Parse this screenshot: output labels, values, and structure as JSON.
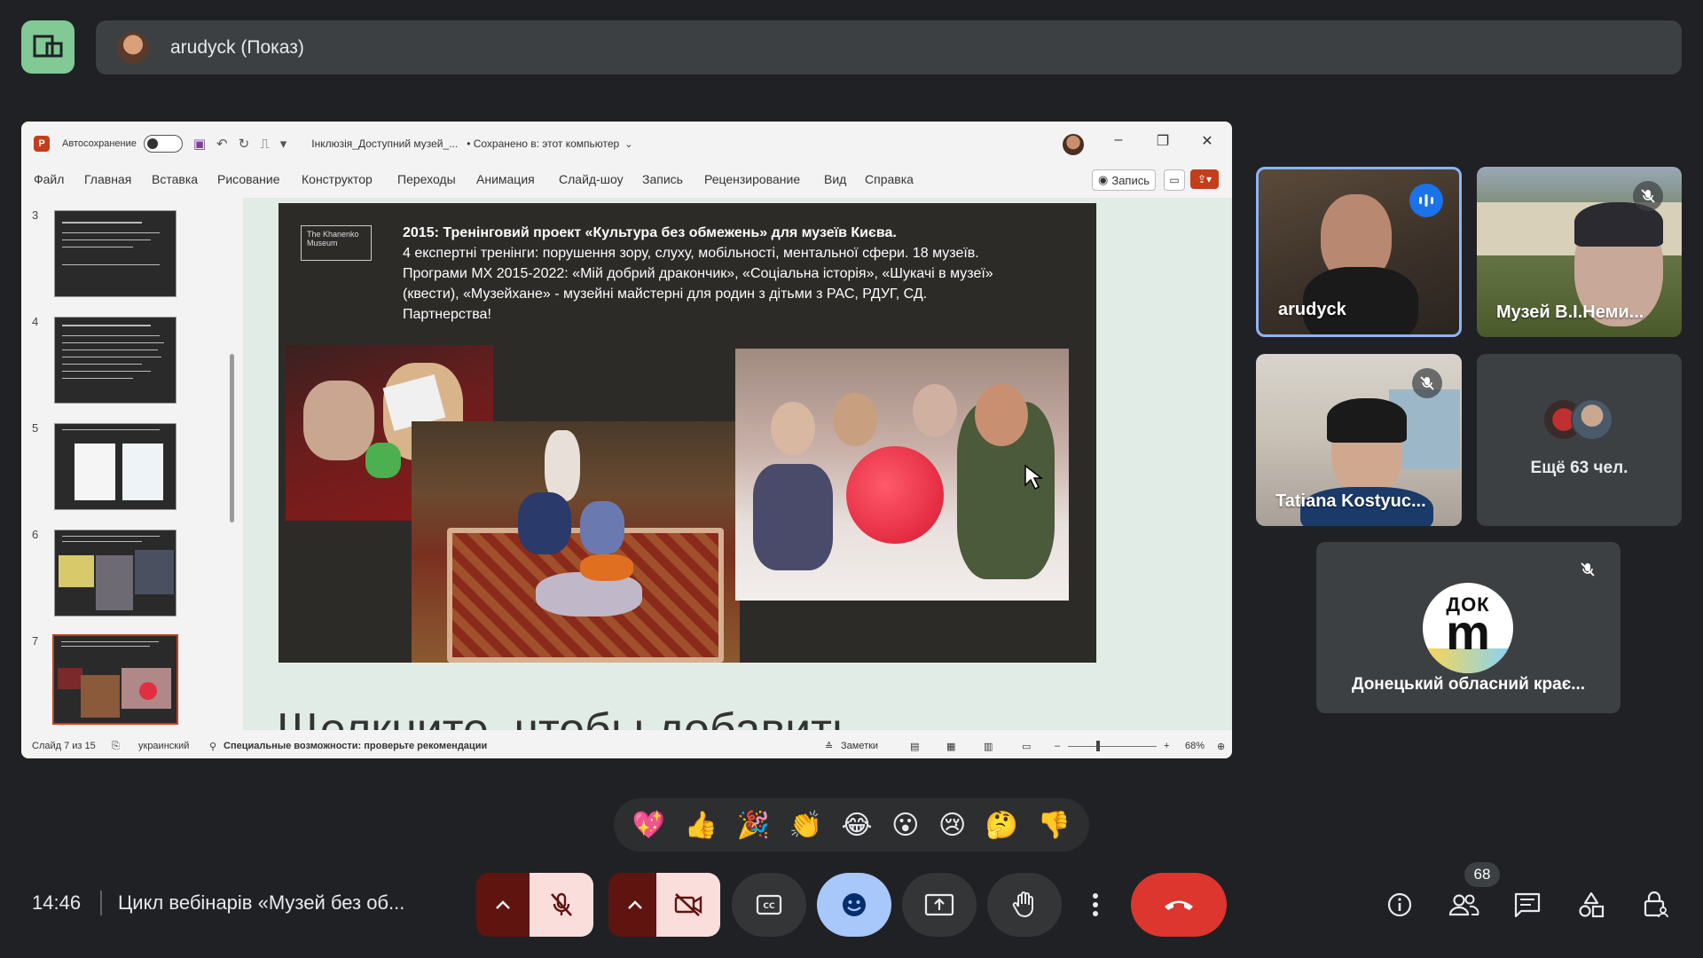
{
  "presenter": {
    "name": "arudyck (Показ)"
  },
  "ppt": {
    "autosave_label": "Автосохранение",
    "doc_title": "Інклюзія_Доступний музей_...",
    "saved_status": "• Сохранено в: этот компьютер",
    "menu": [
      "Файл",
      "Главная",
      "Вставка",
      "Рисование",
      "Конструктор",
      "Переходы",
      "Анимация",
      "Слайд-шоу",
      "Запись",
      "Рецензирование",
      "Вид",
      "Справка"
    ],
    "record_label": "Запись",
    "thumb_numbers": [
      "3",
      "4",
      "5",
      "6",
      "7"
    ],
    "slide": {
      "logo_text": "The Khanenko Museum",
      "title": "2015:  Тренінговий проект «Культура без обмежень» для музеїв Києва.",
      "line1": "4 експертні тренінги: порушення зору, слуху, мобільності, ментальної сфери. 18 музеїв.",
      "line2": "Програми МХ 2015-2022: «Мій добрий дракончик», «Соціальна історія», «Шукачі в музеї»",
      "line3": "(квести), «Музейхане» - музейні майстерні для родин з дітьми з РАС, РДУГ, СД.",
      "line4": "Партнерства!",
      "placeholder": "Щелкните, чтобы добавить"
    },
    "status": {
      "slide_info": "Слайд 7 из 15",
      "language": "украинский",
      "accessibility": "Специальные возможности: проверьте рекомендации",
      "notes": "Заметки",
      "zoom": "68%"
    }
  },
  "participants": [
    {
      "name": "arudyck",
      "speaking": true
    },
    {
      "name": "Музей В.І.Неми...",
      "muted": true
    },
    {
      "name": "Tatiana Kostyuc...",
      "muted": true
    },
    {
      "name": "Ещё 63 чел."
    },
    {
      "name": "Донецький обласний крає...",
      "muted": true,
      "avatar_text_top": "ДОК",
      "avatar_text_main": "m"
    }
  ],
  "reactions": [
    "💖",
    "👍",
    "🎉",
    "👏",
    "😂",
    "😮",
    "😢",
    "🤔",
    "👎"
  ],
  "bottom": {
    "time": "14:46",
    "meeting_title": "Цикл вебінарів «Музей без об...",
    "people_count": "68"
  },
  "colors": {
    "accent_blue": "#a8c7fa",
    "leave_red": "#dc362e",
    "speaking_border": "#8ab4f8"
  }
}
